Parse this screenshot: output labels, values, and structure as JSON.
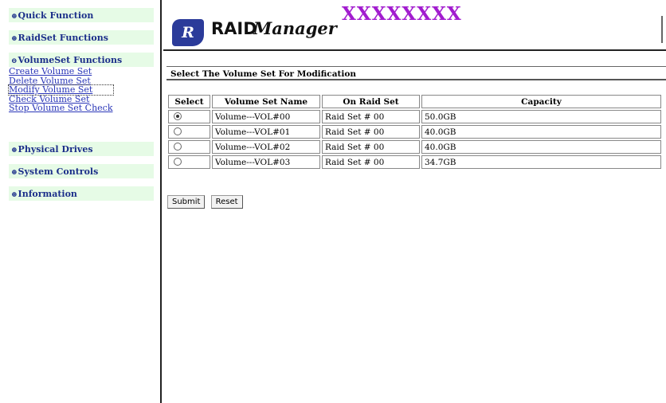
{
  "sidebar": {
    "sections": [
      {
        "label": "Quick Function",
        "bullet": "⊕"
      },
      {
        "label": "RaidSet Functions",
        "bullet": "⊕"
      },
      {
        "label": "VolumeSet Functions",
        "bullet": "⊖"
      },
      {
        "label": "Physical Drives",
        "bullet": "⊕"
      },
      {
        "label": "System Controls",
        "bullet": "⊕"
      },
      {
        "label": "Information",
        "bullet": "⊕"
      }
    ],
    "volume_links": [
      "Create Volume Set",
      "Delete Volume Set",
      "Modify Volume Set",
      "Check Volume Set",
      "Stop Volume Set Check"
    ]
  },
  "header": {
    "logo_badge": "R",
    "logo_raid": "RAID",
    "logo_manager": "Manager",
    "brand": "XXXXXXXX",
    "brand_color": "#a21ccf"
  },
  "main": {
    "title": "Select The Volume Set For Modification",
    "columns": [
      "Select",
      "Volume Set Name",
      "On Raid Set",
      "Capacity"
    ],
    "rows": [
      {
        "selected": true,
        "name": "Volume---VOL#00",
        "raid_set": "Raid Set # 00",
        "capacity": "50.0GB"
      },
      {
        "selected": false,
        "name": "Volume---VOL#01",
        "raid_set": "Raid Set # 00",
        "capacity": "40.0GB"
      },
      {
        "selected": false,
        "name": "Volume---VOL#02",
        "raid_set": "Raid Set # 00",
        "capacity": "40.0GB"
      },
      {
        "selected": false,
        "name": "Volume---VOL#03",
        "raid_set": "Raid Set # 00",
        "capacity": "34.7GB"
      }
    ],
    "submit_label": "Submit",
    "reset_label": "Reset"
  }
}
